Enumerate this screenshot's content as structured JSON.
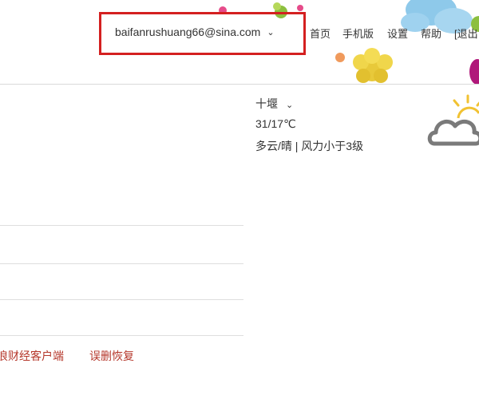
{
  "account": {
    "email": "baifanrushuang66@sina.com"
  },
  "topnav": {
    "home": "首页",
    "mobile": "手机版",
    "settings": "设置",
    "help": "帮助",
    "logout": "[退出"
  },
  "weather": {
    "city": "十堰",
    "temperature": "31/17℃",
    "condition": "多云/晴",
    "separator": "|",
    "wind": "风力小于3级",
    "icon": "cloud-sun-icon"
  },
  "bottom_links": {
    "finance_client": "浪财经客户端",
    "recover_deleted": "误删恢复"
  },
  "colors": {
    "highlight_box": "#d42020",
    "link": "#b5372b",
    "divider": "#d9d9d9"
  }
}
